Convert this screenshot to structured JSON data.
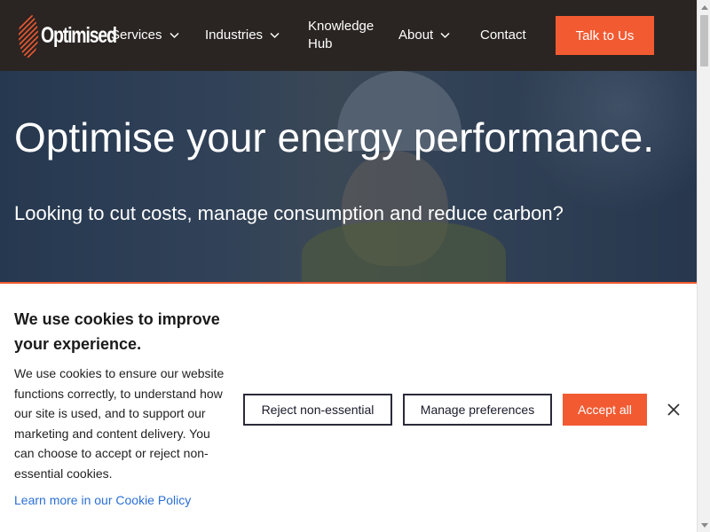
{
  "nav": {
    "logo_text": "Optimised",
    "items": [
      {
        "label": "Services",
        "has_dropdown": true
      },
      {
        "label": "Industries",
        "has_dropdown": true
      },
      {
        "label": "Knowledge Hub",
        "has_dropdown": false
      },
      {
        "label": "About",
        "has_dropdown": true
      },
      {
        "label": "Contact",
        "has_dropdown": false
      }
    ],
    "cta_label": "Talk to Us"
  },
  "hero": {
    "title": "Optimise your energy performance.",
    "subtitle": "Looking to cut costs, manage consumption and reduce carbon?"
  },
  "cookie_banner": {
    "title": "We use cookies to improve your experience.",
    "body": "We use cookies to ensure our website functions correctly, to understand how our site is used, and to support our marketing and content delivery. You can choose to accept or reject non-essential cookies.",
    "link_text": "Learn more in our Cookie Policy",
    "reject_label": "Reject non-essential",
    "manage_label": "Manage preferences",
    "accept_label": "Accept all",
    "close_icon": "close-icon"
  },
  "colors": {
    "accent": "#f25a32",
    "navbar_bg": "#2a2522",
    "link": "#2b6fd6"
  }
}
